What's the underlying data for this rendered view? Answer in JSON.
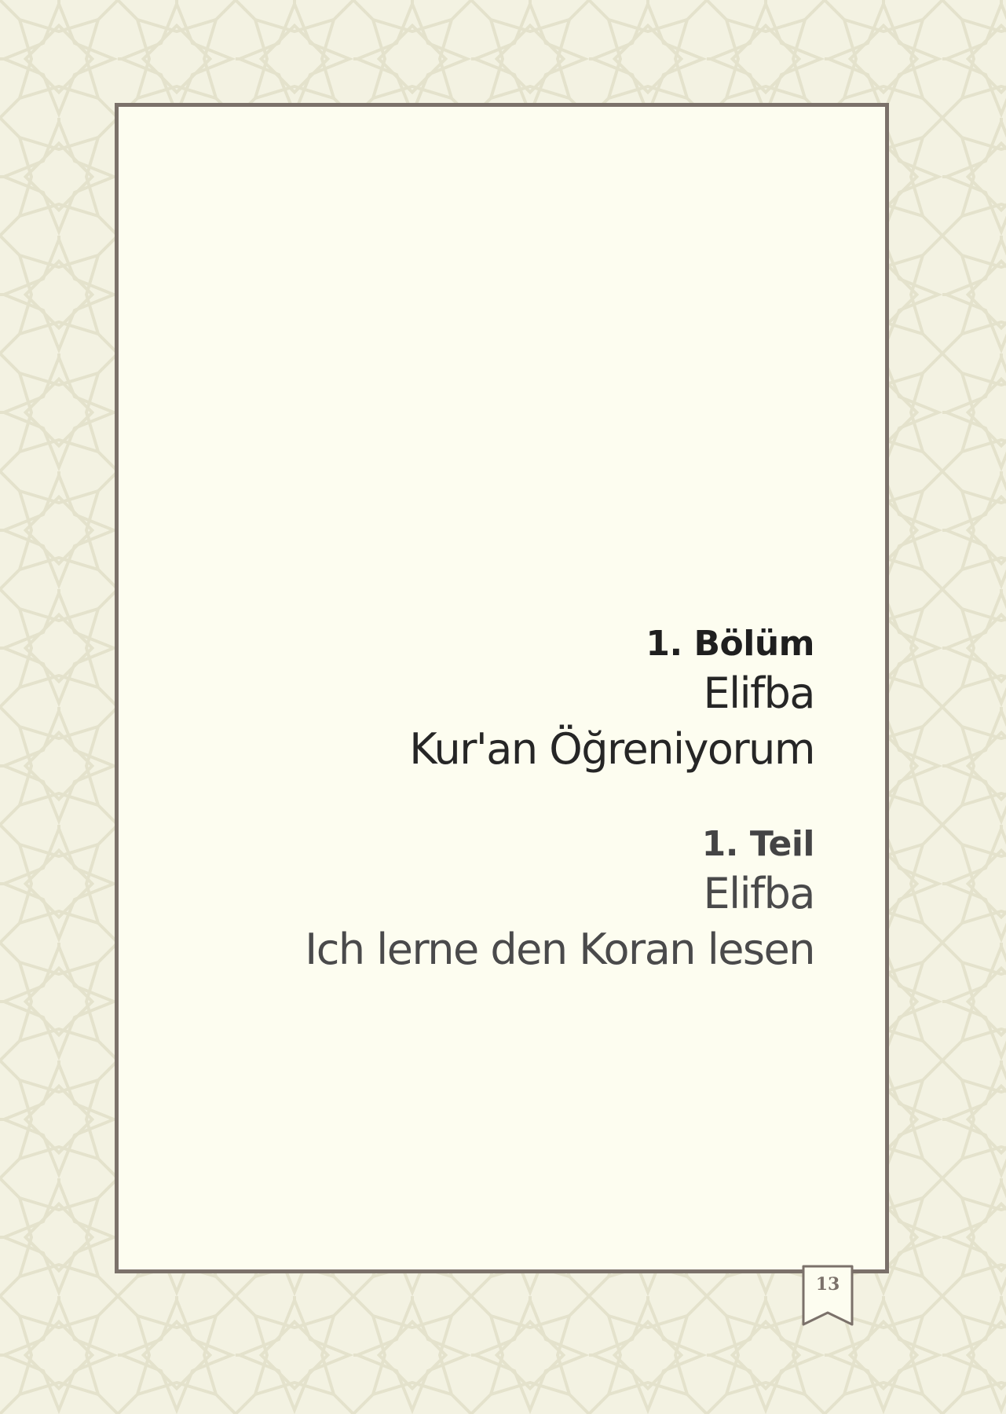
{
  "chapter_tr": {
    "heading": "1. Bölüm",
    "line1": "Elifba",
    "line2": "Kur'an Öğreniyorum"
  },
  "chapter_de": {
    "heading": "1. Teil",
    "line1": "Elifba",
    "line2": "Ich lerne den Koran lesen"
  },
  "page_number": "13",
  "colors": {
    "background": "#f3f2e2",
    "frame_border": "#7b716a",
    "frame_fill": "#fdfdf0",
    "text_primary": "#262626",
    "text_secondary": "#4a4a4b"
  },
  "icons": {
    "bookmark": "bookmark-ribbon-icon",
    "pattern": "geometric-star-pattern"
  }
}
